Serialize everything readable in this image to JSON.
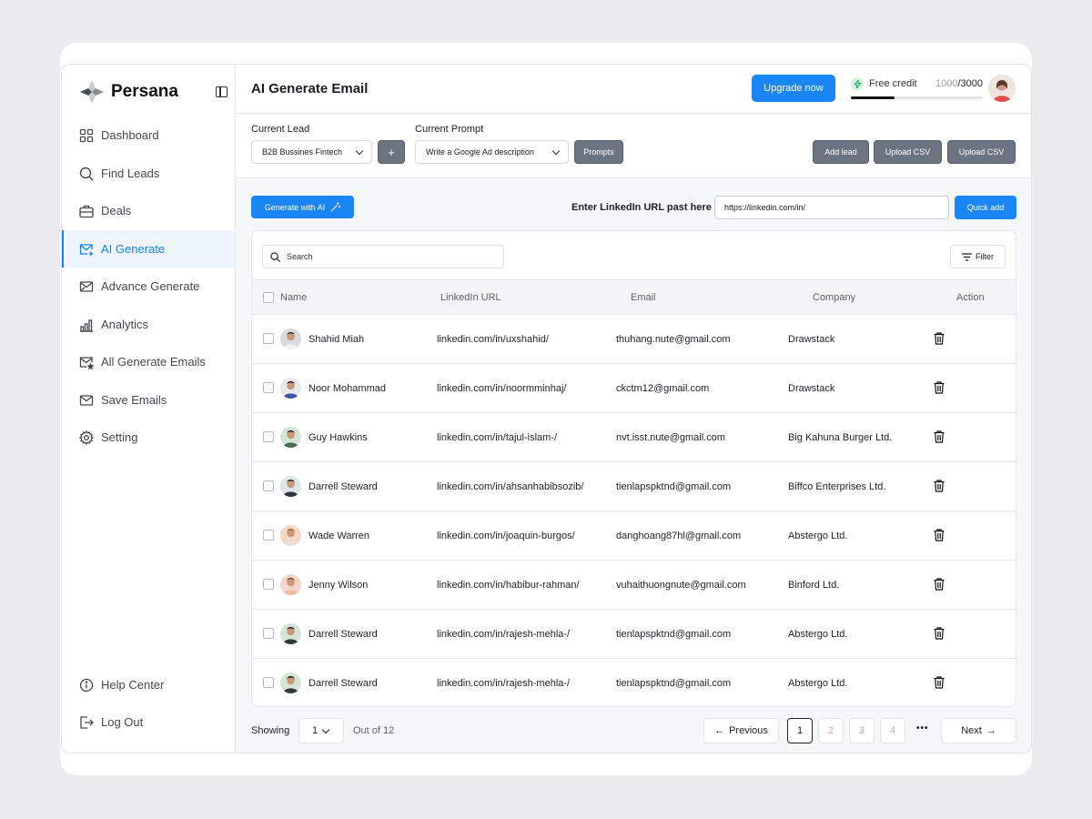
{
  "app": {
    "brand": "Persana"
  },
  "sidebar": {
    "items": [
      {
        "label": "Dashboard",
        "icon": "grid-icon"
      },
      {
        "label": "Find Leads",
        "icon": "search-icon"
      },
      {
        "label": "Deals",
        "icon": "briefcase-icon"
      },
      {
        "label": "AI Generate",
        "icon": "mail-plus-icon",
        "active": true
      },
      {
        "label": "Advance Generate",
        "icon": "mail-open-icon"
      },
      {
        "label": "Analytics",
        "icon": "bar-chart-icon"
      },
      {
        "label": "All Generate Emails",
        "icon": "mail-star-icon"
      },
      {
        "label": "Save Emails",
        "icon": "mail-check-icon"
      },
      {
        "label": "Setting",
        "icon": "gear-icon"
      }
    ],
    "bottom": [
      {
        "label": "Help Center",
        "icon": "info-icon"
      },
      {
        "label": "Log Out",
        "icon": "logout-icon"
      }
    ]
  },
  "header": {
    "title": "AI Generate Email",
    "upgrade_label": "Upgrade now",
    "credit_label": "Free credit",
    "credit_used": "1000",
    "credit_total": "/3000",
    "credit_fraction": 0.33
  },
  "toolbar": {
    "lead_label": "Current Lead",
    "lead_value": "B2B Bussines Fintech",
    "add_label": "+",
    "prompt_label": "Current Prompt",
    "prompt_value": "Write a Google Ad description",
    "prompts_button": "Prompts",
    "add_lead_button": "Add lead",
    "upload_csv_1": "Upload CSV",
    "upload_csv_2": "Upload CSV"
  },
  "actions": {
    "generate_label": "Generate with AI",
    "url_label": "Enter LinkedIn URL past here",
    "url_value": "https://linkedin.com/in/",
    "quick_add_label": "Quick add"
  },
  "table": {
    "search_placeholder": "Search",
    "filter_label": "Filter",
    "columns": [
      "Name",
      "LinkedIn URL",
      "Email",
      "Company",
      "Action"
    ],
    "rows": [
      {
        "name": "Shahid Miah",
        "url": "linkedin.com/in/uxshahid/",
        "email": "thuhang.nute@gmail.com",
        "company": "Drawstack"
      },
      {
        "name": "Noor Mohammad",
        "url": "linkedin.com/in/noormminhaj/",
        "email": "ckctm12@gmail.com",
        "company": "Drawstack"
      },
      {
        "name": "Guy Hawkins",
        "url": "linkedin.com/in/tajul-islam-/",
        "email": "nvt.isst.nute@gmail.com",
        "company": "Big Kahuna Burger Ltd."
      },
      {
        "name": "Darrell Steward",
        "url": "linkedin.com/in/ahsanhabibsozib/",
        "email": "tienlapspktnd@gmail.com",
        "company": "Biffco Enterprises Ltd."
      },
      {
        "name": "Wade Warren",
        "url": "linkedin.com/in/joaquin-burgos/",
        "email": "danghoang87hl@gmail.com",
        "company": "Abstergo Ltd."
      },
      {
        "name": "Jenny Wilson",
        "url": "linkedin.com/in/habibur-rahman/",
        "email": "vuhaithuongnute@gmail.com",
        "company": "Binford Ltd."
      },
      {
        "name": "Darrell Steward",
        "url": "linkedin.com/in/rajesh-mehla-/",
        "email": "tienlapspktnd@gmail.com",
        "company": "Abstergo Ltd."
      },
      {
        "name": "Darrell Steward",
        "url": "linkedin.com/in/rajesh-mehla-/",
        "email": "tienlapspktnd@gmail.com",
        "company": "Abstergo Ltd."
      }
    ]
  },
  "pagination": {
    "showing_label": "Showing",
    "per_page": "1",
    "out_of": "Out of 12",
    "previous": "Previous",
    "pages": [
      "1",
      "2",
      "3",
      "4"
    ],
    "ellipsis": "•••",
    "next": "Next"
  },
  "colors": {
    "accent": "#1a86f5",
    "active_bg": "#eef5fe",
    "gray_button": "#6b7480"
  }
}
